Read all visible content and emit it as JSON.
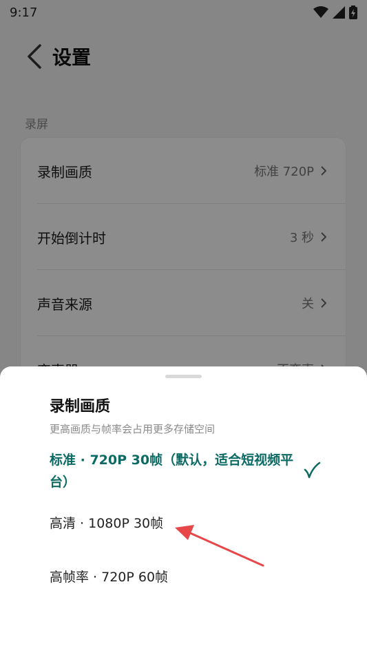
{
  "status_bar": {
    "time": "9:17"
  },
  "header": {
    "title": "设置"
  },
  "section": {
    "label": "录屏"
  },
  "settings": [
    {
      "label": "录制画质",
      "value": "标准 720P"
    },
    {
      "label": "开始倒计时",
      "value": "3 秒"
    },
    {
      "label": "声音来源",
      "value": "关"
    },
    {
      "label": "变声器",
      "value": "不变声"
    }
  ],
  "sheet": {
    "title": "录制画质",
    "subtitle": "更高画质与帧率会占用更多存储空间",
    "options": [
      {
        "label": "标准 · 720P 30帧（默认，适合短视频平台）",
        "selected": true
      },
      {
        "label": "高清 · 1080P 30帧",
        "selected": false
      },
      {
        "label": "高帧率 · 720P 60帧",
        "selected": false
      }
    ]
  },
  "colors": {
    "accent": "#0b6b64",
    "annotation_arrow": "#e8474a"
  },
  "icons": [
    "wifi-icon",
    "signal-icon",
    "battery-icon",
    "back-chevron-icon",
    "chevron-right-icon",
    "check-icon"
  ]
}
